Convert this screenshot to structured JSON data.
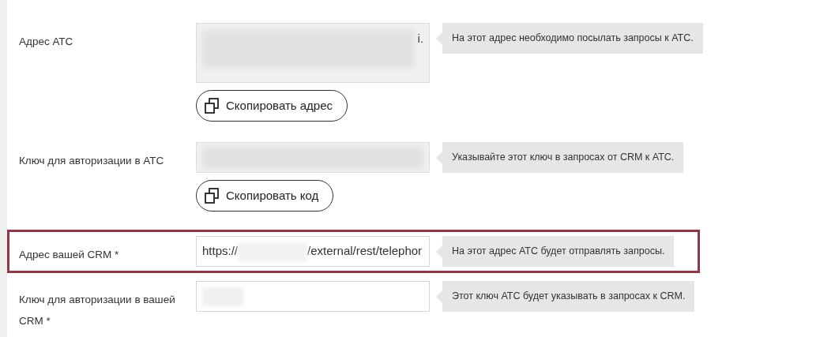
{
  "rows": [
    {
      "label": "Адрес АТС",
      "field": {
        "kind": "readonly",
        "multiline": true,
        "blurred": true,
        "value_end": "i."
      },
      "hint": "На этот адрес необходимо посылать запросы к АТС.",
      "button": "Скопировать адрес",
      "highlighted": false
    },
    {
      "label": "Ключ для авторизации в АТС",
      "field": {
        "kind": "readonly",
        "multiline": false,
        "blurred": true
      },
      "hint": "Указывайте этот ключ в запросах от CRM к АТС.",
      "button": "Скопировать код",
      "highlighted": false
    },
    {
      "label": "Адрес вашей CRM *",
      "field": {
        "kind": "input",
        "multiline": false,
        "blurred": true,
        "value_start": "https://",
        "value_end": "/external/rest/telephor"
      },
      "hint": "На этот адрес АТС будет отправлять запросы.",
      "highlighted": true
    },
    {
      "label": "Ключ для авторизации в вашей CRM *",
      "field": {
        "kind": "input",
        "multiline": false,
        "blurred": true
      },
      "hint": "Этот ключ АТС будет указывать в запросах к CRM.",
      "highlighted": false
    }
  ]
}
